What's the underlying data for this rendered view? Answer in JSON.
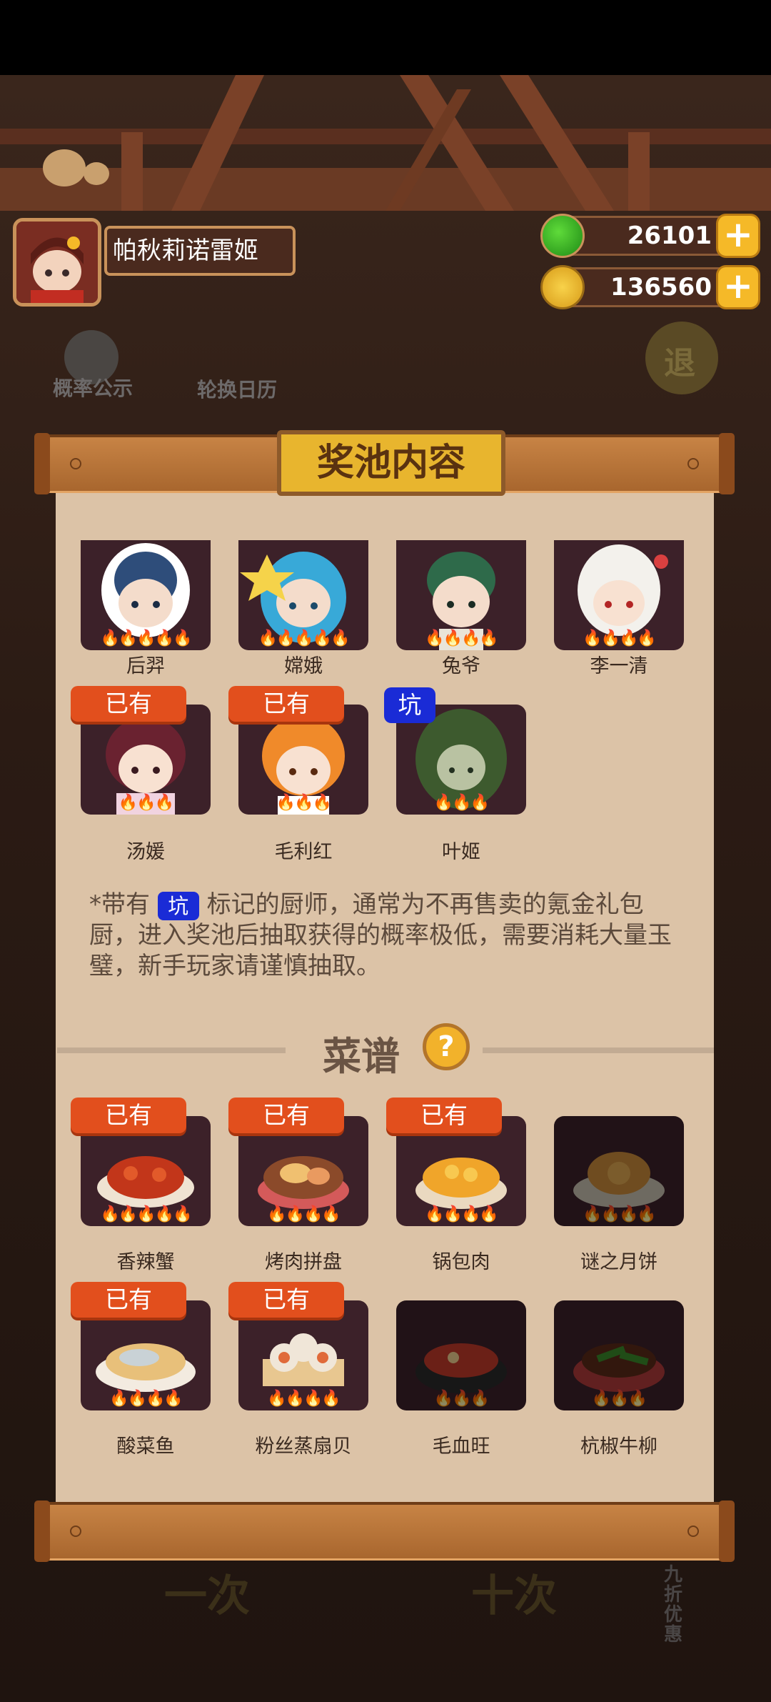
{
  "player": {
    "name": "帕秋莉诺雷姬"
  },
  "currency": {
    "jade": "26101",
    "coins": "136560"
  },
  "background": {
    "probability_label": "概率公示",
    "calendar_label": "轮换日历",
    "exit_label": "退",
    "single_draw": "一次",
    "ten_draw": "十次",
    "discount": "九折优惠"
  },
  "pool": {
    "title": "奖池内容",
    "chefs": [
      {
        "name": "后羿",
        "owned": false,
        "pit": false
      },
      {
        "name": "嫦娥",
        "owned": false,
        "pit": false
      },
      {
        "name": "兔爷",
        "owned": false,
        "pit": false
      },
      {
        "name": "李一清",
        "owned": false,
        "pit": false
      },
      {
        "name": "汤媛",
        "owned": true,
        "pit": false
      },
      {
        "name": "毛利红",
        "owned": true,
        "pit": false
      },
      {
        "name": "叶姬",
        "owned": false,
        "pit": true
      }
    ],
    "owned_label": "已有",
    "pit_label": "坑",
    "note_prefix": "*带有",
    "note_text": "标记的厨师，通常为不再售卖的氪金礼包厨，进入奖池后抽取获得的概率极低，需要消耗大量玉璧，新手玩家请谨慎抽取。",
    "recipes_title": "菜谱",
    "help": "?",
    "recipes": [
      {
        "name": "香辣蟹",
        "owned": true
      },
      {
        "name": "烤肉拼盘",
        "owned": true
      },
      {
        "name": "锅包肉",
        "owned": true
      },
      {
        "name": "谜之月饼",
        "owned": false
      },
      {
        "name": "酸菜鱼",
        "owned": true
      },
      {
        "name": "粉丝蒸扇贝",
        "owned": true
      },
      {
        "name": "毛血旺",
        "owned": false
      },
      {
        "name": "杭椒牛柳",
        "owned": false
      }
    ]
  }
}
